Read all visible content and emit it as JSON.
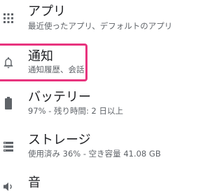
{
  "settings": {
    "items": [
      {
        "title": "アプリ",
        "subtitle": "最近使ったアプリ、デフォルトのアプリ",
        "icon": "apps-grid-icon"
      },
      {
        "title": "通知",
        "subtitle": "通知履歴、会話",
        "icon": "bell-icon"
      },
      {
        "title": "バッテリー",
        "subtitle": "97% - 残り時間: 2 日以上",
        "icon": "battery-icon"
      },
      {
        "title": "ストレージ",
        "subtitle": "使用済み 36% - 空き容量 41.08 GB",
        "icon": "storage-icon"
      },
      {
        "title": "音",
        "subtitle": "",
        "icon": "sound-icon"
      }
    ]
  },
  "colors": {
    "highlight": "#e8347e",
    "icon": "#5f6368",
    "title": "#202124",
    "subtitle": "#5f6368"
  }
}
